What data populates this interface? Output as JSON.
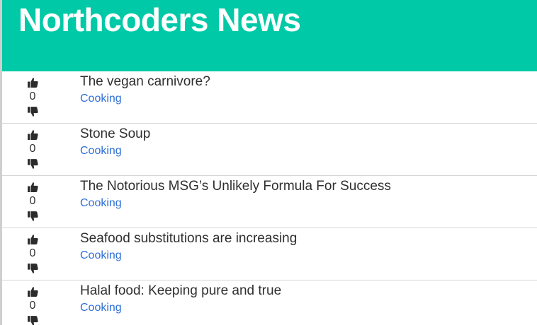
{
  "header": {
    "title": "Northcoders News",
    "background_color": "#00c9a7"
  },
  "articles": [
    {
      "title": "The vegan carnivore?",
      "topic": "Cooking",
      "votes": "0"
    },
    {
      "title": "Stone Soup",
      "topic": "Cooking",
      "votes": "0"
    },
    {
      "title": "The Notorious MSG’s Unlikely Formula For Success",
      "topic": "Cooking",
      "votes": "0"
    },
    {
      "title": "Seafood substitutions are increasing",
      "topic": "Cooking",
      "votes": "0"
    },
    {
      "title": "Halal food: Keeping pure and true",
      "topic": "Cooking",
      "votes": "0"
    }
  ],
  "icons": {
    "upvote": "thumbs-up-icon",
    "downvote": "thumbs-down-icon"
  },
  "colors": {
    "topic_link": "#2f6fd6",
    "text": "#2f2f2f"
  }
}
